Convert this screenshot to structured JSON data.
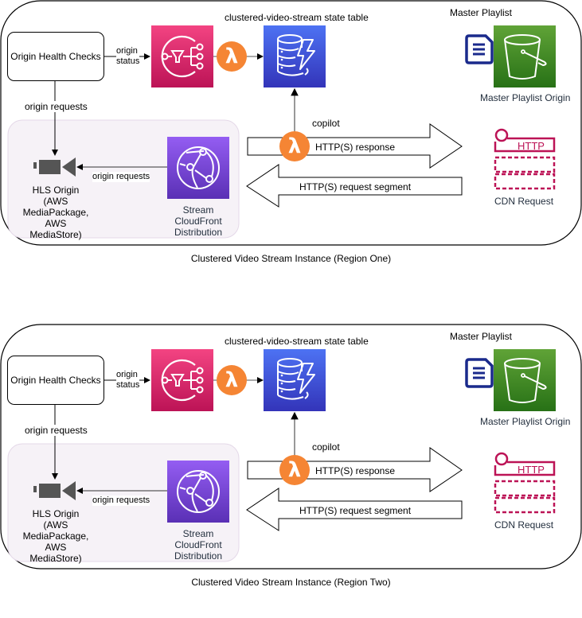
{
  "regions": [
    {
      "title": "Clustered Video Stream Instance (Region One)",
      "origin_health_checks": "Origin Health Checks",
      "origin_status_line1": "origin",
      "origin_status_line2": "status",
      "origin_requests_vertical": "origin requests",
      "state_table": "clustered-video-stream state table",
      "master_playlist": "Master Playlist",
      "master_playlist_origin": "Master Playlist Origin",
      "copilot": "copilot",
      "http_response": "HTTP(S) response",
      "http_request_segment": "HTTP(S) request segment",
      "cdn_request": "CDN Request",
      "http_badge": "HTTP",
      "origin_requests_horizontal": "origin requests",
      "hls_origin_lines": [
        "HLS Origin",
        "(AWS",
        "MediaPackage,",
        "AWS",
        "MediaStore)"
      ],
      "cloudfront_lines": [
        "Stream",
        "CloudFront",
        "Distribution"
      ],
      "lambda_glyph": "λ"
    },
    {
      "title": "Clustered Video Stream Instance (Region Two)",
      "origin_health_checks": "Origin Health Checks",
      "origin_status_line1": "origin",
      "origin_status_line2": "status",
      "origin_requests_vertical": "origin requests",
      "state_table": "clustered-video-stream state table",
      "master_playlist": "Master Playlist",
      "master_playlist_origin": "Master Playlist Origin",
      "copilot": "copilot",
      "http_response": "HTTP(S) response",
      "http_request_segment": "HTTP(S) request segment",
      "cdn_request": "CDN Request",
      "http_badge": "HTTP",
      "origin_requests_horizontal": "origin requests",
      "hls_origin_lines": [
        "HLS Origin",
        "(AWS",
        "MediaPackage,",
        "AWS",
        "MediaStore)"
      ],
      "cloudfront_lines": [
        "Stream",
        "CloudFront",
        "Distribution"
      ],
      "lambda_glyph": "λ"
    }
  ],
  "colors": {
    "sns_pink": "#CC2264",
    "dynamodb_blue": "#3F48CC",
    "s3_green": "#3F8624",
    "cloudfront_purple": "#8C4FFF",
    "lambda_orange": "#F58534",
    "cdn_magenta": "#BC1356",
    "doc_navy": "#1A2A8C",
    "group_fill": "#F6F2F7"
  }
}
